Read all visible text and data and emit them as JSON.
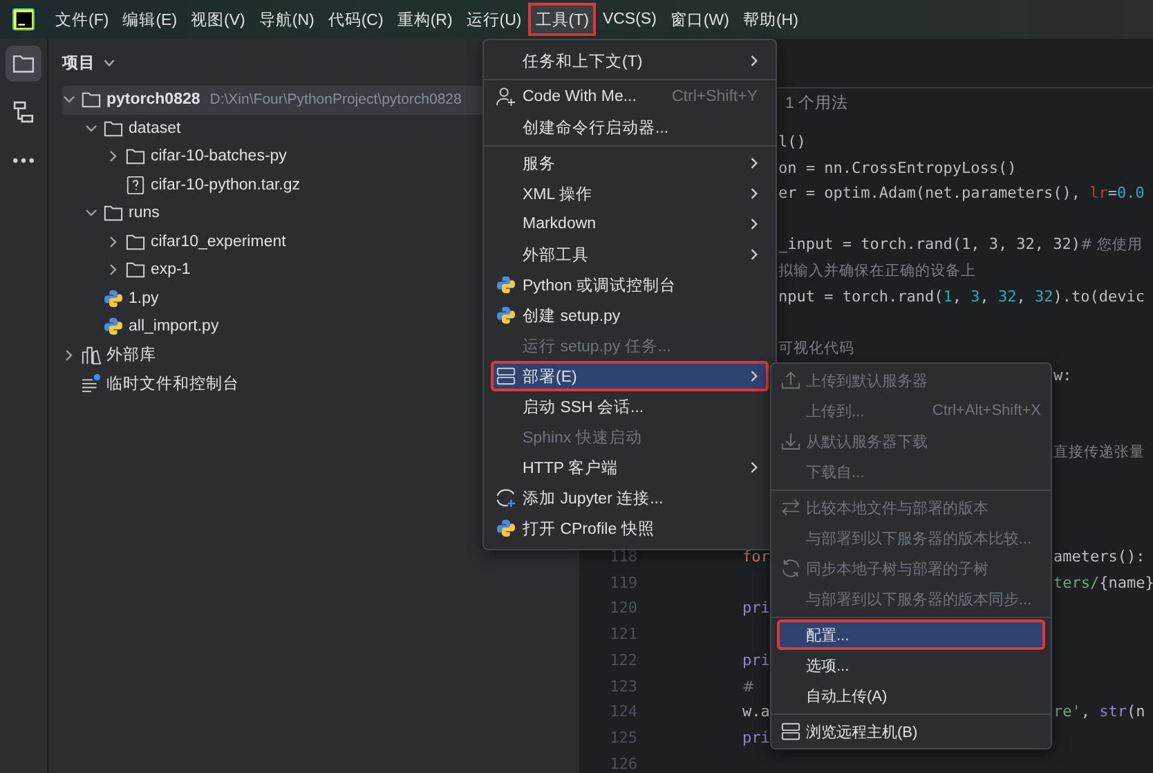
{
  "menu_bar": [
    {
      "label": "文件(F)",
      "selected": false,
      "annotated": false
    },
    {
      "label": "编辑(E)",
      "selected": false,
      "annotated": false
    },
    {
      "label": "视图(V)",
      "selected": false,
      "annotated": false
    },
    {
      "label": "导航(N)",
      "selected": false,
      "annotated": false
    },
    {
      "label": "代码(C)",
      "selected": false,
      "annotated": false
    },
    {
      "label": "重构(R)",
      "selected": false,
      "annotated": false
    },
    {
      "label": "运行(U)",
      "selected": false,
      "annotated": false
    },
    {
      "label": "工具(T)",
      "selected": true,
      "annotated": true
    },
    {
      "label": "VCS(S)",
      "selected": false,
      "annotated": false
    },
    {
      "label": "窗口(W)",
      "selected": false,
      "annotated": false
    },
    {
      "label": "帮助(H)",
      "selected": false,
      "annotated": false
    }
  ],
  "tool_strip": [
    {
      "selected": true
    },
    {
      "selected": false
    },
    {
      "selected": false
    }
  ],
  "project_panel": {
    "title": "项目",
    "tree": [
      {
        "label": "pytorch0828",
        "path": "D:\\Xin\\Four\\PythonProject\\pytorch0828",
        "kind": "folder",
        "expanded": true,
        "selected": true,
        "children": [
          {
            "label": "dataset",
            "kind": "folder",
            "expanded": true,
            "selected": false,
            "children": [
              {
                "label": "cifar-10-batches-py",
                "kind": "folder",
                "expanded": false,
                "selected": false
              },
              {
                "label": "cifar-10-python.tar.gz",
                "kind": "file",
                "selected": false
              }
            ]
          },
          {
            "label": "runs",
            "kind": "folder",
            "expanded": true,
            "selected": false,
            "children": [
              {
                "label": "cifar10_experiment",
                "kind": "folder",
                "expanded": false,
                "selected": false
              },
              {
                "label": "exp-1",
                "kind": "folder",
                "expanded": false,
                "selected": false
              }
            ]
          },
          {
            "label": "1.py",
            "kind": "python",
            "selected": false
          },
          {
            "label": "all_import.py",
            "kind": "python",
            "selected": false
          }
        ]
      },
      {
        "label": "外部库",
        "kind": "library",
        "expanded": false,
        "selected": false
      },
      {
        "label": "临时文件和控制台",
        "kind": "scratch",
        "selected": false
      }
    ]
  },
  "editor": {
    "usage_hint": "1 个用法",
    "lines": [
      {
        "kind": "code",
        "tail": [
          {
            "text": "l()",
            "kind": "plain"
          }
        ]
      },
      {
        "kind": "code",
        "tail": [
          {
            "text": "on = nn.CrossEntropyLoss()",
            "kind": "plain"
          }
        ]
      },
      {
        "kind": "code",
        "tail": [
          {
            "text": "er = optim.Adam(net.parameters(), ",
            "kind": "plain"
          },
          {
            "text": "lr",
            "kind": "param"
          },
          {
            "text": "=",
            "kind": "plain"
          },
          {
            "text": "0.0",
            "kind": "number"
          }
        ]
      },
      {
        "kind": "blank"
      },
      {
        "kind": "code",
        "tail": [
          {
            "text": "_input = torch.rand(1, 3, 32, 32)",
            "kind": "plain"
          },
          {
            "text": "# 您使用",
            "kind": "comment"
          }
        ]
      },
      {
        "kind": "code",
        "tail": [
          {
            "text": "拟输入并确保在正确的设备上",
            "kind": "comment"
          }
        ]
      },
      {
        "kind": "code",
        "tail": [
          {
            "text": "nput = torch.rand(",
            "kind": "plain"
          },
          {
            "text": "1",
            "kind": "number"
          },
          {
            "text": ", ",
            "kind": "plain"
          },
          {
            "text": "3",
            "kind": "number"
          },
          {
            "text": ", ",
            "kind": "plain"
          },
          {
            "text": "32",
            "kind": "number"
          },
          {
            "text": ", ",
            "kind": "plain"
          },
          {
            "text": "32",
            "kind": "number"
          },
          {
            "text": ").to(devic",
            "kind": "plain"
          }
        ]
      },
      {
        "kind": "blank"
      },
      {
        "kind": "code",
        "tail": [
          {
            "text": "可视化代码",
            "kind": "comment"
          }
        ]
      },
      {
        "kind": "code",
        "tail": [
          {
            "text": "w:",
            "kind": "plain"
          }
        ]
      },
      {
        "kind": "blank"
      },
      {
        "kind": "blank"
      },
      {
        "kind": "code",
        "tail": [
          {
            "text": "直接传递张量",
            "kind": "comment"
          }
        ]
      },
      {
        "kind": "blank"
      },
      {
        "kind": "blank"
      },
      {
        "kind": "blank"
      },
      {
        "kind": "code",
        "number": "118",
        "head": [
          {
            "text": "for",
            "kind": "keyword"
          }
        ],
        "tail": [
          {
            "text": "ameters():",
            "kind": "plain"
          }
        ]
      },
      {
        "kind": "code",
        "number": "119",
        "tail": [
          {
            "text": "ters/",
            "kind": "string"
          },
          {
            "text": "{name}",
            "kind": "plain"
          }
        ]
      },
      {
        "kind": "code",
        "number": "120",
        "head": [
          {
            "text": "pri",
            "kind": "builtin"
          }
        ]
      },
      {
        "kind": "code",
        "number": "121"
      },
      {
        "kind": "code",
        "number": "122",
        "head": [
          {
            "text": "pri",
            "kind": "builtin"
          }
        ]
      },
      {
        "kind": "code",
        "number": "123",
        "head": [
          {
            "text": "#",
            "kind": "comment"
          }
        ]
      },
      {
        "kind": "code",
        "number": "124",
        "head": [
          {
            "text": "w.a",
            "kind": "plain"
          }
        ],
        "tail": [
          {
            "text": "re'",
            "kind": "string"
          },
          {
            "text": ", ",
            "kind": "plain"
          },
          {
            "text": "str",
            "kind": "builtin"
          },
          {
            "text": "(n",
            "kind": "plain"
          }
        ]
      },
      {
        "kind": "code",
        "number": "125",
        "head": [
          {
            "text": "pri",
            "kind": "builtin"
          }
        ]
      },
      {
        "kind": "code",
        "number": "126"
      }
    ]
  },
  "tools_menu": [
    {
      "kind": "plain",
      "label": "任务和上下文(T)",
      "submenu": true,
      "disabled": false,
      "selected": false,
      "annotated": false
    },
    {
      "kind": "separator"
    },
    {
      "kind": "person-add",
      "label": "Code With Me...",
      "shortcut": "Ctrl+Shift+Y",
      "submenu": false,
      "disabled": false,
      "selected": false,
      "annotated": false
    },
    {
      "kind": "plain",
      "label": "创建命令行启动器...",
      "submenu": false,
      "disabled": false,
      "selected": false,
      "annotated": false
    },
    {
      "kind": "separator"
    },
    {
      "kind": "plain",
      "label": "服务",
      "submenu": true,
      "disabled": false,
      "selected": false,
      "annotated": false
    },
    {
      "kind": "plain",
      "label": "XML 操作",
      "submenu": true,
      "disabled": false,
      "selected": false,
      "annotated": false
    },
    {
      "kind": "plain",
      "label": "Markdown",
      "submenu": true,
      "disabled": false,
      "selected": false,
      "annotated": false
    },
    {
      "kind": "plain",
      "label": "外部工具",
      "submenu": true,
      "disabled": false,
      "selected": false,
      "annotated": false
    },
    {
      "kind": "python",
      "label": "Python 或调试控制台",
      "submenu": false,
      "disabled": false,
      "selected": false,
      "annotated": false
    },
    {
      "kind": "python",
      "label": "创建 setup.py",
      "submenu": false,
      "disabled": false,
      "selected": false,
      "annotated": false
    },
    {
      "kind": "plain",
      "label": "运行 setup.py 任务...",
      "submenu": false,
      "disabled": true,
      "selected": false,
      "annotated": false
    },
    {
      "kind": "server",
      "label": "部署(E)",
      "submenu": true,
      "disabled": false,
      "selected": true,
      "annotated": true
    },
    {
      "kind": "plain",
      "label": "启动 SSH 会话...",
      "submenu": false,
      "disabled": false,
      "selected": false,
      "annotated": false
    },
    {
      "kind": "plain",
      "label": "Sphinx 快速启动",
      "submenu": false,
      "disabled": true,
      "selected": false,
      "annotated": false
    },
    {
      "kind": "plain",
      "label": "HTTP 客户端",
      "submenu": true,
      "disabled": false,
      "selected": false,
      "annotated": false
    },
    {
      "kind": "jupyter",
      "label": "添加 Jupyter 连接...",
      "submenu": false,
      "disabled": false,
      "selected": false,
      "annotated": false
    },
    {
      "kind": "python",
      "label": "打开 CProfile 快照",
      "submenu": false,
      "disabled": false,
      "selected": false,
      "annotated": false
    }
  ],
  "deploy_submenu": [
    {
      "kind": "upload",
      "label": "上传到默认服务器",
      "disabled": true,
      "selected": false,
      "annotated": false
    },
    {
      "kind": "plain",
      "label": "上传到...",
      "shortcut": "Ctrl+Alt+Shift+X",
      "disabled": true,
      "selected": false,
      "annotated": false
    },
    {
      "kind": "download",
      "label": "从默认服务器下载",
      "disabled": true,
      "selected": false,
      "annotated": false
    },
    {
      "kind": "plain",
      "label": "下载自...",
      "disabled": true,
      "selected": false,
      "annotated": false
    },
    {
      "kind": "separator"
    },
    {
      "kind": "compare",
      "label": "比较本地文件与部署的版本",
      "disabled": true,
      "selected": false,
      "annotated": false
    },
    {
      "kind": "plain",
      "label": "与部署到以下服务器的版本比较...",
      "disabled": true,
      "selected": false,
      "annotated": false
    },
    {
      "kind": "sync",
      "label": "同步本地子树与部署的子树",
      "disabled": true,
      "selected": false,
      "annotated": false
    },
    {
      "kind": "plain",
      "label": "与部署到以下服务器的版本同步...",
      "disabled": true,
      "selected": false,
      "annotated": false
    },
    {
      "kind": "separator"
    },
    {
      "kind": "plain",
      "label": "配置...",
      "disabled": false,
      "selected": true,
      "annotated": true
    },
    {
      "kind": "plain",
      "label": "选项...",
      "disabled": false,
      "selected": false,
      "annotated": false
    },
    {
      "kind": "plain",
      "label": "自动上传(A)",
      "disabled": false,
      "selected": false,
      "annotated": false
    },
    {
      "kind": "separator"
    },
    {
      "kind": "server",
      "label": "浏览远程主机(B)",
      "disabled": false,
      "selected": false,
      "annotated": false
    }
  ]
}
